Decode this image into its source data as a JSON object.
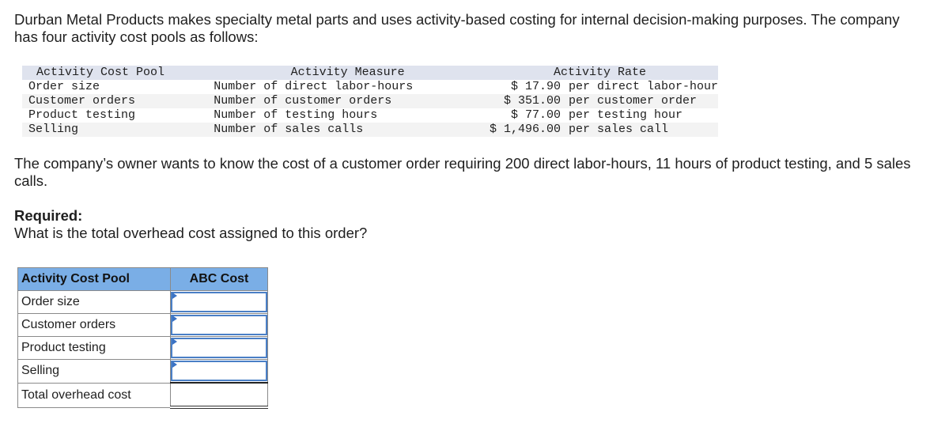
{
  "intro": "Durban Metal Products makes specialty metal parts and uses activity-based costing for internal decision-making purposes. The company has four activity cost pools as follows:",
  "rate_table": {
    "headers": [
      "Activity Cost Pool",
      "Activity Measure",
      "Activity Rate"
    ],
    "rows": [
      {
        "pool": "Order size",
        "measure": "Number of direct labor-hours",
        "rate": "$ 17.90",
        "unit": "per direct labor-hour"
      },
      {
        "pool": "Customer orders",
        "measure": "Number of customer orders",
        "rate": "$ 351.00",
        "unit": "per customer order"
      },
      {
        "pool": "Product testing",
        "measure": "Number of testing hours",
        "rate": "$ 77.00",
        "unit": "per testing hour"
      },
      {
        "pool": "Selling",
        "measure": "Number of sales calls",
        "rate": "$ 1,496.00",
        "unit": "per sales call"
      }
    ]
  },
  "question": "The company’s owner wants to know the cost of a customer order requiring 200 direct labor-hours, 11 hours of product testing, and 5 sales calls.",
  "required": {
    "label": "Required:",
    "text": "What is the total overhead cost assigned to this order?"
  },
  "answer_table": {
    "headers": [
      "Activity Cost Pool",
      "ABC Cost"
    ],
    "rows": [
      {
        "label": "Order size",
        "value": ""
      },
      {
        "label": "Customer orders",
        "value": ""
      },
      {
        "label": "Product testing",
        "value": ""
      },
      {
        "label": "Selling",
        "value": ""
      }
    ],
    "total": {
      "label": "Total overhead cost",
      "value": ""
    }
  },
  "colors": {
    "answer_header": "#7aaee6",
    "input_border": "#4a7fc6",
    "rate_header": "#dfe3ee"
  }
}
